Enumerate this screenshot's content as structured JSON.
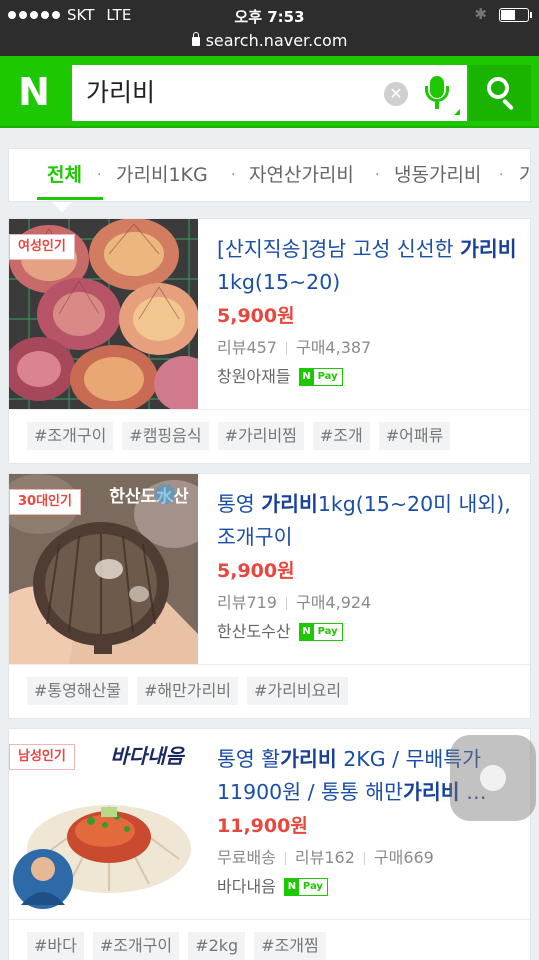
{
  "status": {
    "carrier": "SKT",
    "network": "LTE",
    "time": "오후 7:53",
    "battery_level": 0.55
  },
  "url": "search.naver.com",
  "header": {
    "logo": "N",
    "query": "가리비",
    "clear_icon": "clear-icon",
    "mic_icon": "mic-icon",
    "search_icon": "search-icon",
    "brand_color": "#1ec800"
  },
  "tabs": [
    {
      "label": "전체",
      "active": true
    },
    {
      "label": "가리비1KG"
    },
    {
      "label": "자연산가리비"
    },
    {
      "label": "냉동가리비"
    },
    {
      "label": "가"
    }
  ],
  "products": [
    {
      "badge": "여성인기",
      "title_pre": "[산지직송]경남 고성 신선한 ",
      "title_bold": "가리비",
      "title_post": " 1kg(15~20)",
      "price": "5,900원",
      "meta": [
        "리뷰457",
        "구매4,387"
      ],
      "seller": "창원아재들",
      "npay": {
        "n": "N",
        "p": "Pay"
      },
      "tags": [
        "#조개구이",
        "#캠핑음식",
        "#가리비찜",
        "#조개",
        "#어패류"
      ]
    },
    {
      "badge": "30대인기",
      "title_pre": "통영 ",
      "title_bold": "가리비",
      "title_post": "1kg(15~20미 내외),조개구이",
      "price": "5,900원",
      "meta": [
        "리뷰719",
        "구매4,924"
      ],
      "seller": "한산도수산",
      "npay": {
        "n": "N",
        "p": "Pay"
      },
      "logo_text": "한산도水산",
      "tags": [
        "#통영해산물",
        "#해만가리비",
        "#가리비요리"
      ]
    },
    {
      "badge": "남성인기",
      "title_pre": "통영 활",
      "title_bold": "가리비",
      "title_post": " 2KG / 무배특가 11900원 / 통통 해만",
      "title_bold2": "가리비",
      "title_post2": " …",
      "price": "11,900원",
      "meta": [
        "무료배송",
        "리뷰162",
        "구매669"
      ],
      "seller": "바다내음",
      "npay": {
        "n": "N",
        "p": "Pay"
      },
      "logo_text": "바다내음",
      "tags": [
        "#바다",
        "#조개구이",
        "#2kg",
        "#조개찜"
      ]
    }
  ]
}
